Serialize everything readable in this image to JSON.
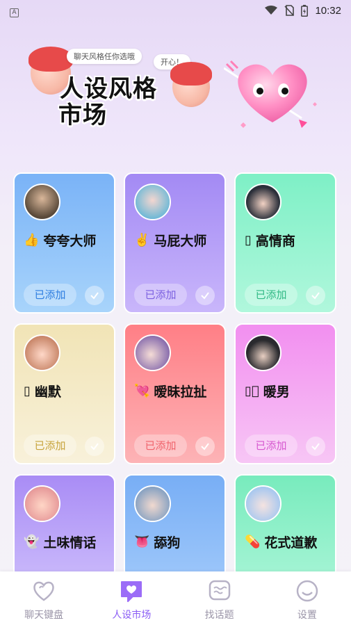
{
  "status_bar": {
    "left_icon": "a-box-icon",
    "time": "10:32",
    "icons": [
      "wifi-icon",
      "no-sim-icon",
      "battery-icon"
    ]
  },
  "banner": {
    "title_line1": "人设风格",
    "title_line2": "市场",
    "bubble_1": "聊天风格任你选哦",
    "bubble_2": "开心！",
    "decorations": [
      "cartoon-face-left",
      "cartoon-face-right",
      "heart-with-arrow"
    ]
  },
  "cards": [
    {
      "emoji": "👍",
      "name": "夸夸大师",
      "added_label": "已添加",
      "color": "#7ab3f7",
      "avatar_color": "#5a4a3a"
    },
    {
      "emoji": "✌️",
      "name": "马屁大师",
      "added_label": "已添加",
      "color": "#a38af4",
      "avatar_color": "#6ab8d6"
    },
    {
      "emoji": "▯",
      "name": "高情商",
      "added_label": "已添加",
      "color": "#7ef0c6",
      "avatar_color": "#2b2f3a"
    },
    {
      "emoji": "▯",
      "name": "幽默",
      "added_label": "已添加",
      "color": "#f1e4b6",
      "avatar_color": "#f0b9a0"
    },
    {
      "emoji": "💘",
      "name": "暧昧拉扯",
      "added_label": "已添加",
      "color": "#ff7f86",
      "avatar_color": "#8a6fae"
    },
    {
      "emoji": "▯🏻",
      "name": "暖男",
      "added_label": "已添加",
      "color": "#f28ff0",
      "avatar_color": "#2a2a2e"
    },
    {
      "emoji": "👻",
      "name": "土味情话",
      "color": "#a98cf5",
      "avatar_color": "#e79a9a"
    },
    {
      "emoji": "👅",
      "name": "舔狗",
      "color": "#78aef5",
      "avatar_color": "#8aa3c2"
    },
    {
      "emoji": "💊",
      "name": "花式道歉",
      "color": "#78ebbd",
      "avatar_color": "#a9c8ef"
    }
  ],
  "bottom_nav": [
    {
      "label": "聊天键盘",
      "icon": "heart-outline-icon",
      "active": false
    },
    {
      "label": "人设市场",
      "icon": "heart-chat-icon",
      "active": true
    },
    {
      "label": "找话题",
      "icon": "chat-wave-icon",
      "active": false
    },
    {
      "label": "设置",
      "icon": "smile-circle-icon",
      "active": false
    }
  ]
}
